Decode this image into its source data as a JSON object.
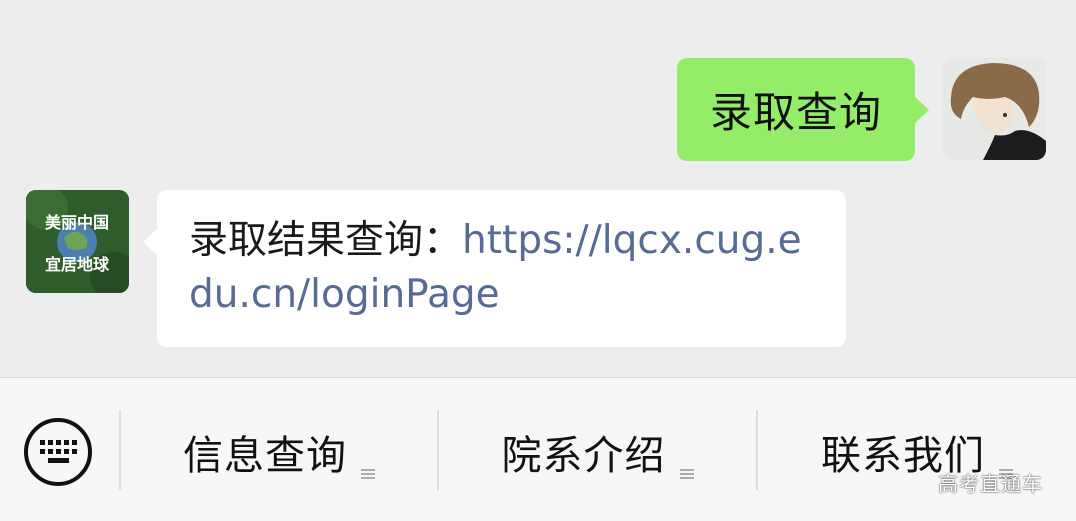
{
  "chat": {
    "outgoing": {
      "text": "录取查询",
      "avatar_icon": "user-avatar-icon",
      "bubble_color": "#95ec69"
    },
    "incoming": {
      "prefix": "录取结果查询：",
      "link": "https://lqcx.cug.edu.cn/loginPage",
      "link_color": "#576b95",
      "avatar_icon": "account-logo-icon",
      "avatar_text_top": "美丽中国",
      "avatar_text_bottom": "宜居地球"
    }
  },
  "menu": {
    "keyboard_icon": "keyboard-icon",
    "items": [
      {
        "label": "信息查询",
        "icon": "submenu-icon"
      },
      {
        "label": "院系介绍",
        "icon": "submenu-icon"
      },
      {
        "label": "联系我们",
        "icon": "submenu-icon"
      }
    ]
  },
  "watermark": "高考直通车"
}
